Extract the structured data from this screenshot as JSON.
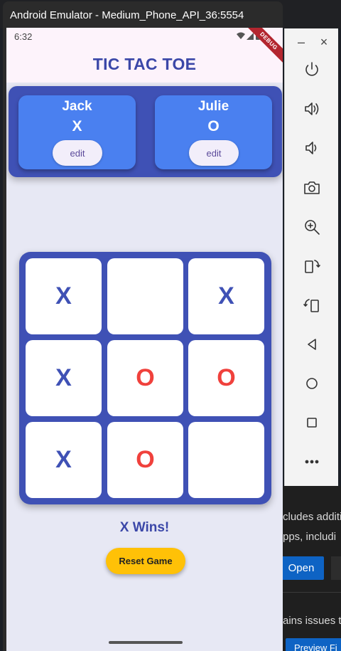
{
  "emulator": {
    "window_title": "Android Emulator - Medium_Phone_API_36:5554",
    "minimize_glyph": "–",
    "close_glyph": "×",
    "toolbar_icons": [
      "power-icon",
      "volume-up-icon",
      "volume-down-icon",
      "camera-icon",
      "zoom-in-icon",
      "rotate-left-icon",
      "rotate-right-icon",
      "back-icon",
      "home-icon",
      "overview-icon",
      "more-icon"
    ]
  },
  "status_bar": {
    "time": "6:32",
    "debug_banner": "DEBUG"
  },
  "app": {
    "title": "TIC TAC TOE",
    "players": [
      {
        "name": "Jack",
        "symbol": "X",
        "edit_label": "edit"
      },
      {
        "name": "Julie",
        "symbol": "O",
        "edit_label": "edit"
      }
    ],
    "board": [
      [
        "X",
        "",
        "X"
      ],
      [
        "X",
        "O",
        "O"
      ],
      [
        "X",
        "O",
        ""
      ]
    ],
    "result": "X Wins!",
    "reset_label": "Reset Game"
  },
  "background": {
    "text_line_1": "cludes additi",
    "text_line_2": "pps, includi",
    "open_button": "Open",
    "text_line_3": "ains issues t",
    "preview_button": "Preview Fi"
  },
  "colors": {
    "primary": "#3f51b5",
    "player_card": "#4a80f0",
    "o_mark": "#f0413c",
    "reset_button": "#ffc107"
  }
}
